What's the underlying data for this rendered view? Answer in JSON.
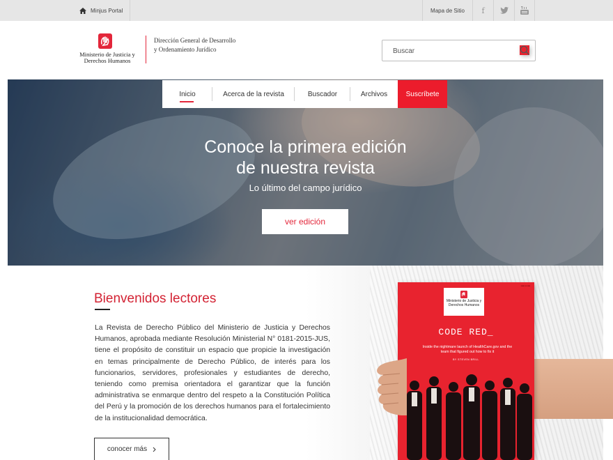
{
  "topbar": {
    "portal_label": "Minjus Portal",
    "sitemap_label": "Mapa de Sitio",
    "social": [
      {
        "icon": "facebook-icon",
        "glyph": "f"
      },
      {
        "icon": "twitter-icon",
        "glyph": "🐦"
      },
      {
        "icon": "youtube-icon",
        "glyph": "▶"
      }
    ]
  },
  "header": {
    "logo_text": "Ministerio de Justicia y Derechos Humanos",
    "department": "Dirección General de Desarrollo y Ordenamiento Jurídico",
    "search_placeholder": "Buscar"
  },
  "nav": {
    "items": [
      {
        "label": "Inicio",
        "active": true
      },
      {
        "label": "Acerca de la revista",
        "active": false
      },
      {
        "label": "Buscador",
        "active": false
      },
      {
        "label": "Archivos",
        "active": false
      }
    ],
    "subscribe_label": "Suscríbete"
  },
  "hero": {
    "title_line1": "Conoce la primera edición",
    "title_line2": "de nuestra revista",
    "subtitle": "Lo último del campo jurídico",
    "button_label": "ver edición"
  },
  "welcome": {
    "title": "Bienvenidos lectores",
    "body": "La Revista de Derecho Público del Ministerio de Justicia y Derechos Humanos, aprobada mediante Resolución Ministerial N° 0181-2015-JUS, tiene el propósito de constituir un espacio que propicie la investigación en temas principalmente de Derecho Público, de interés para los funcionarios, servidores, profesionales y estudiantes de derecho, teniendo como premisa orientadora el garantizar que la función administrativa se enmarque dentro del respeto a la Constitución Política del Perú y la promoción de los derechos humanos para el fortalecimiento de la institucionalidad democrática.",
    "button_label": "conocer más"
  },
  "magazine": {
    "badge_text": "Ministerio de Justicia y Derechos Humanos",
    "headline": "CODE RED_",
    "deck": "Inside the nightmare launch of HealthCare.gov and the team that figured out how to fix it",
    "byline": "BY STEVEN BRILL"
  },
  "colors": {
    "brand_red": "#e3263a",
    "subscribe_red": "#ec1c2c",
    "topbar_gray": "#e6e6e6"
  }
}
